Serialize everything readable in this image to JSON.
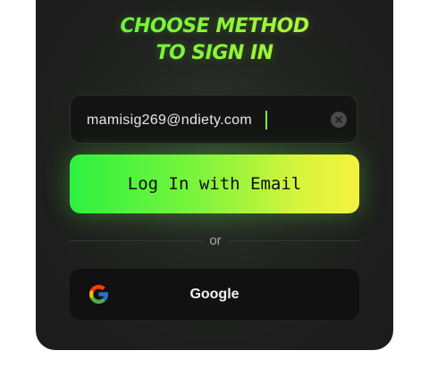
{
  "header": {
    "title_line1": "CHOOSE METHOD",
    "title_line2": "TO SIGN IN"
  },
  "email_field": {
    "value": "mamisig269@ndiety.com",
    "clear_icon": "clear-circle-x-icon"
  },
  "login_button": {
    "label": "Log In with Email"
  },
  "divider": {
    "label": "or"
  },
  "google_button": {
    "label": "Google",
    "icon": "google-logo-icon"
  },
  "colors": {
    "accent_start": "#2bf23f",
    "accent_end": "#f4f23e",
    "card_background": "#1b1b1b",
    "input_background": "#141414"
  }
}
